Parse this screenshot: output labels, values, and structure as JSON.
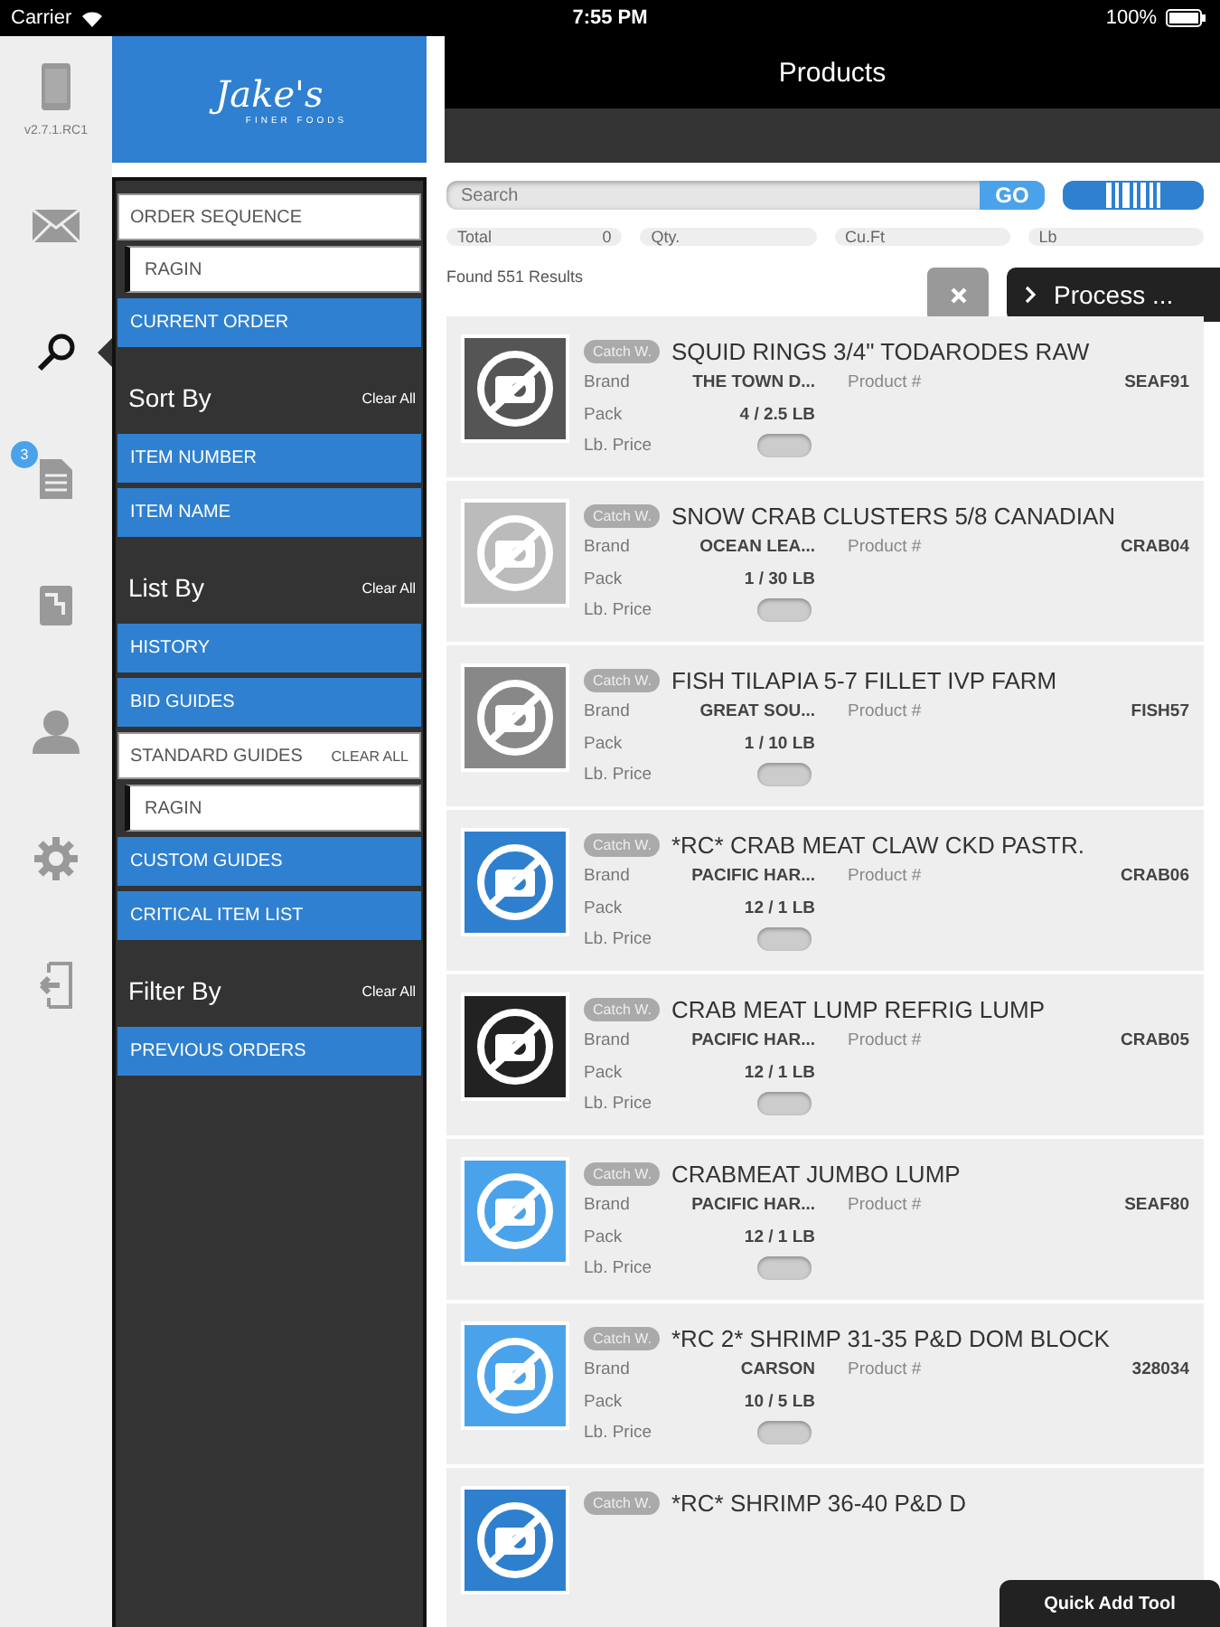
{
  "status_bar": {
    "carrier": "Carrier",
    "time": "7:55 PM",
    "battery": "100%"
  },
  "rail": {
    "version": "v2.7.1.RC1",
    "items": [
      {
        "kind": "device",
        "selected": false
      },
      {
        "kind": "mail",
        "selected": false
      },
      {
        "kind": "search",
        "selected": true
      },
      {
        "kind": "orders",
        "selected": false,
        "badge": "3"
      },
      {
        "kind": "document",
        "selected": false
      },
      {
        "kind": "person",
        "selected": false
      },
      {
        "kind": "settings",
        "selected": false
      },
      {
        "kind": "logout",
        "selected": false
      }
    ]
  },
  "logo": {
    "name": "Jake's",
    "tagline": "FINER FOODS"
  },
  "panel": [
    {
      "kind": "field",
      "label": "ORDER SEQUENCE"
    },
    {
      "kind": "subfield",
      "label": "RAGIN"
    },
    {
      "kind": "option",
      "label": "CURRENT ORDER"
    },
    {
      "kind": "header",
      "label": "Sort By",
      "action": "Clear All"
    },
    {
      "kind": "option",
      "label": "ITEM NUMBER"
    },
    {
      "kind": "option",
      "label": "ITEM NAME"
    },
    {
      "kind": "header",
      "label": "List By",
      "action": "Clear All"
    },
    {
      "kind": "option",
      "label": "HISTORY"
    },
    {
      "kind": "option",
      "label": "BID GUIDES"
    },
    {
      "kind": "field",
      "label": "STANDARD GUIDES",
      "action": "CLEAR ALL"
    },
    {
      "kind": "subfield",
      "label": "RAGIN"
    },
    {
      "kind": "option",
      "label": "CUSTOM GUIDES"
    },
    {
      "kind": "option",
      "label": "CRITICAL ITEM LIST"
    },
    {
      "kind": "header",
      "label": "Filter By",
      "action": "Clear All"
    },
    {
      "kind": "option",
      "label": "PREVIOUS ORDERS"
    }
  ],
  "header": {
    "title": "Products"
  },
  "search": {
    "placeholder": "Search",
    "go": "GO"
  },
  "totals": [
    {
      "label": "Total",
      "value": "0"
    },
    {
      "label": "Qty."
    },
    {
      "label": "Cu.Ft"
    },
    {
      "label": "Lb"
    }
  ],
  "results": "Found 551 Results",
  "process_button": "Process ...",
  "products": [
    {
      "tag": "Catch W.",
      "title": "SQUID RINGS 3/4\" TODARODES RAW",
      "brand_label": "Brand",
      "brand": "THE TOWN D...",
      "product_label": "Product #",
      "product": "SEAF91",
      "pack_label": "Pack",
      "pack": "4 / 2.5 LB",
      "price_label": "Lb. Price",
      "color": "#555555"
    },
    {
      "tag": "Catch W.",
      "title": "SNOW CRAB CLUSTERS 5/8 CANADIAN",
      "brand_label": "Brand",
      "brand": "OCEAN LEA...",
      "product_label": "Product #",
      "product": "CRAB04",
      "pack_label": "Pack",
      "pack": "1 / 30 LB",
      "price_label": "Lb. Price",
      "color": "#bbbbbb"
    },
    {
      "tag": "Catch W.",
      "title": "FISH TILAPIA 5-7 FILLET IVP FARM",
      "brand_label": "Brand",
      "brand": "GREAT SOU...",
      "product_label": "Product #",
      "product": "FISH57",
      "pack_label": "Pack",
      "pack": "1 / 10 LB",
      "price_label": "Lb. Price",
      "color": "#888888"
    },
    {
      "tag": "Catch W.",
      "title": "*RC* CRAB MEAT CLAW CKD PASTR.",
      "brand_label": "Brand",
      "brand": "PACIFIC HAR...",
      "product_label": "Product #",
      "product": "CRAB06",
      "pack_label": "Pack",
      "pack": "12 / 1 LB",
      "price_label": "Lb. Price",
      "color": "#2f7fcf"
    },
    {
      "tag": "Catch W.",
      "title": "CRAB MEAT LUMP REFRIG LUMP",
      "brand_label": "Brand",
      "brand": "PACIFIC HAR...",
      "product_label": "Product #",
      "product": "CRAB05",
      "pack_label": "Pack",
      "pack": "12 / 1 LB",
      "price_label": "Lb. Price",
      "color": "#222222"
    },
    {
      "tag": "Catch W.",
      "title": "CRABMEAT JUMBO LUMP",
      "brand_label": "Brand",
      "brand": "PACIFIC HAR...",
      "product_label": "Product #",
      "product": "SEAF80",
      "pack_label": "Pack",
      "pack": "12 / 1 LB",
      "price_label": "Lb. Price",
      "color": "#4aa3ea"
    },
    {
      "tag": "Catch W.",
      "title": "*RC 2* SHRIMP 31-35 P&D DOM BLOCK",
      "brand_label": "Brand",
      "brand": "CARSON",
      "product_label": "Product #",
      "product": "328034",
      "pack_label": "Pack",
      "pack": "10 / 5 LB",
      "price_label": "Lb. Price",
      "color": "#4aa3ea"
    },
    {
      "tag": "Catch W.",
      "title": "*RC* SHRIMP 36-40 P&D D",
      "color": "#2f7fcf"
    }
  ],
  "quick_add": "Quick Add Tool"
}
